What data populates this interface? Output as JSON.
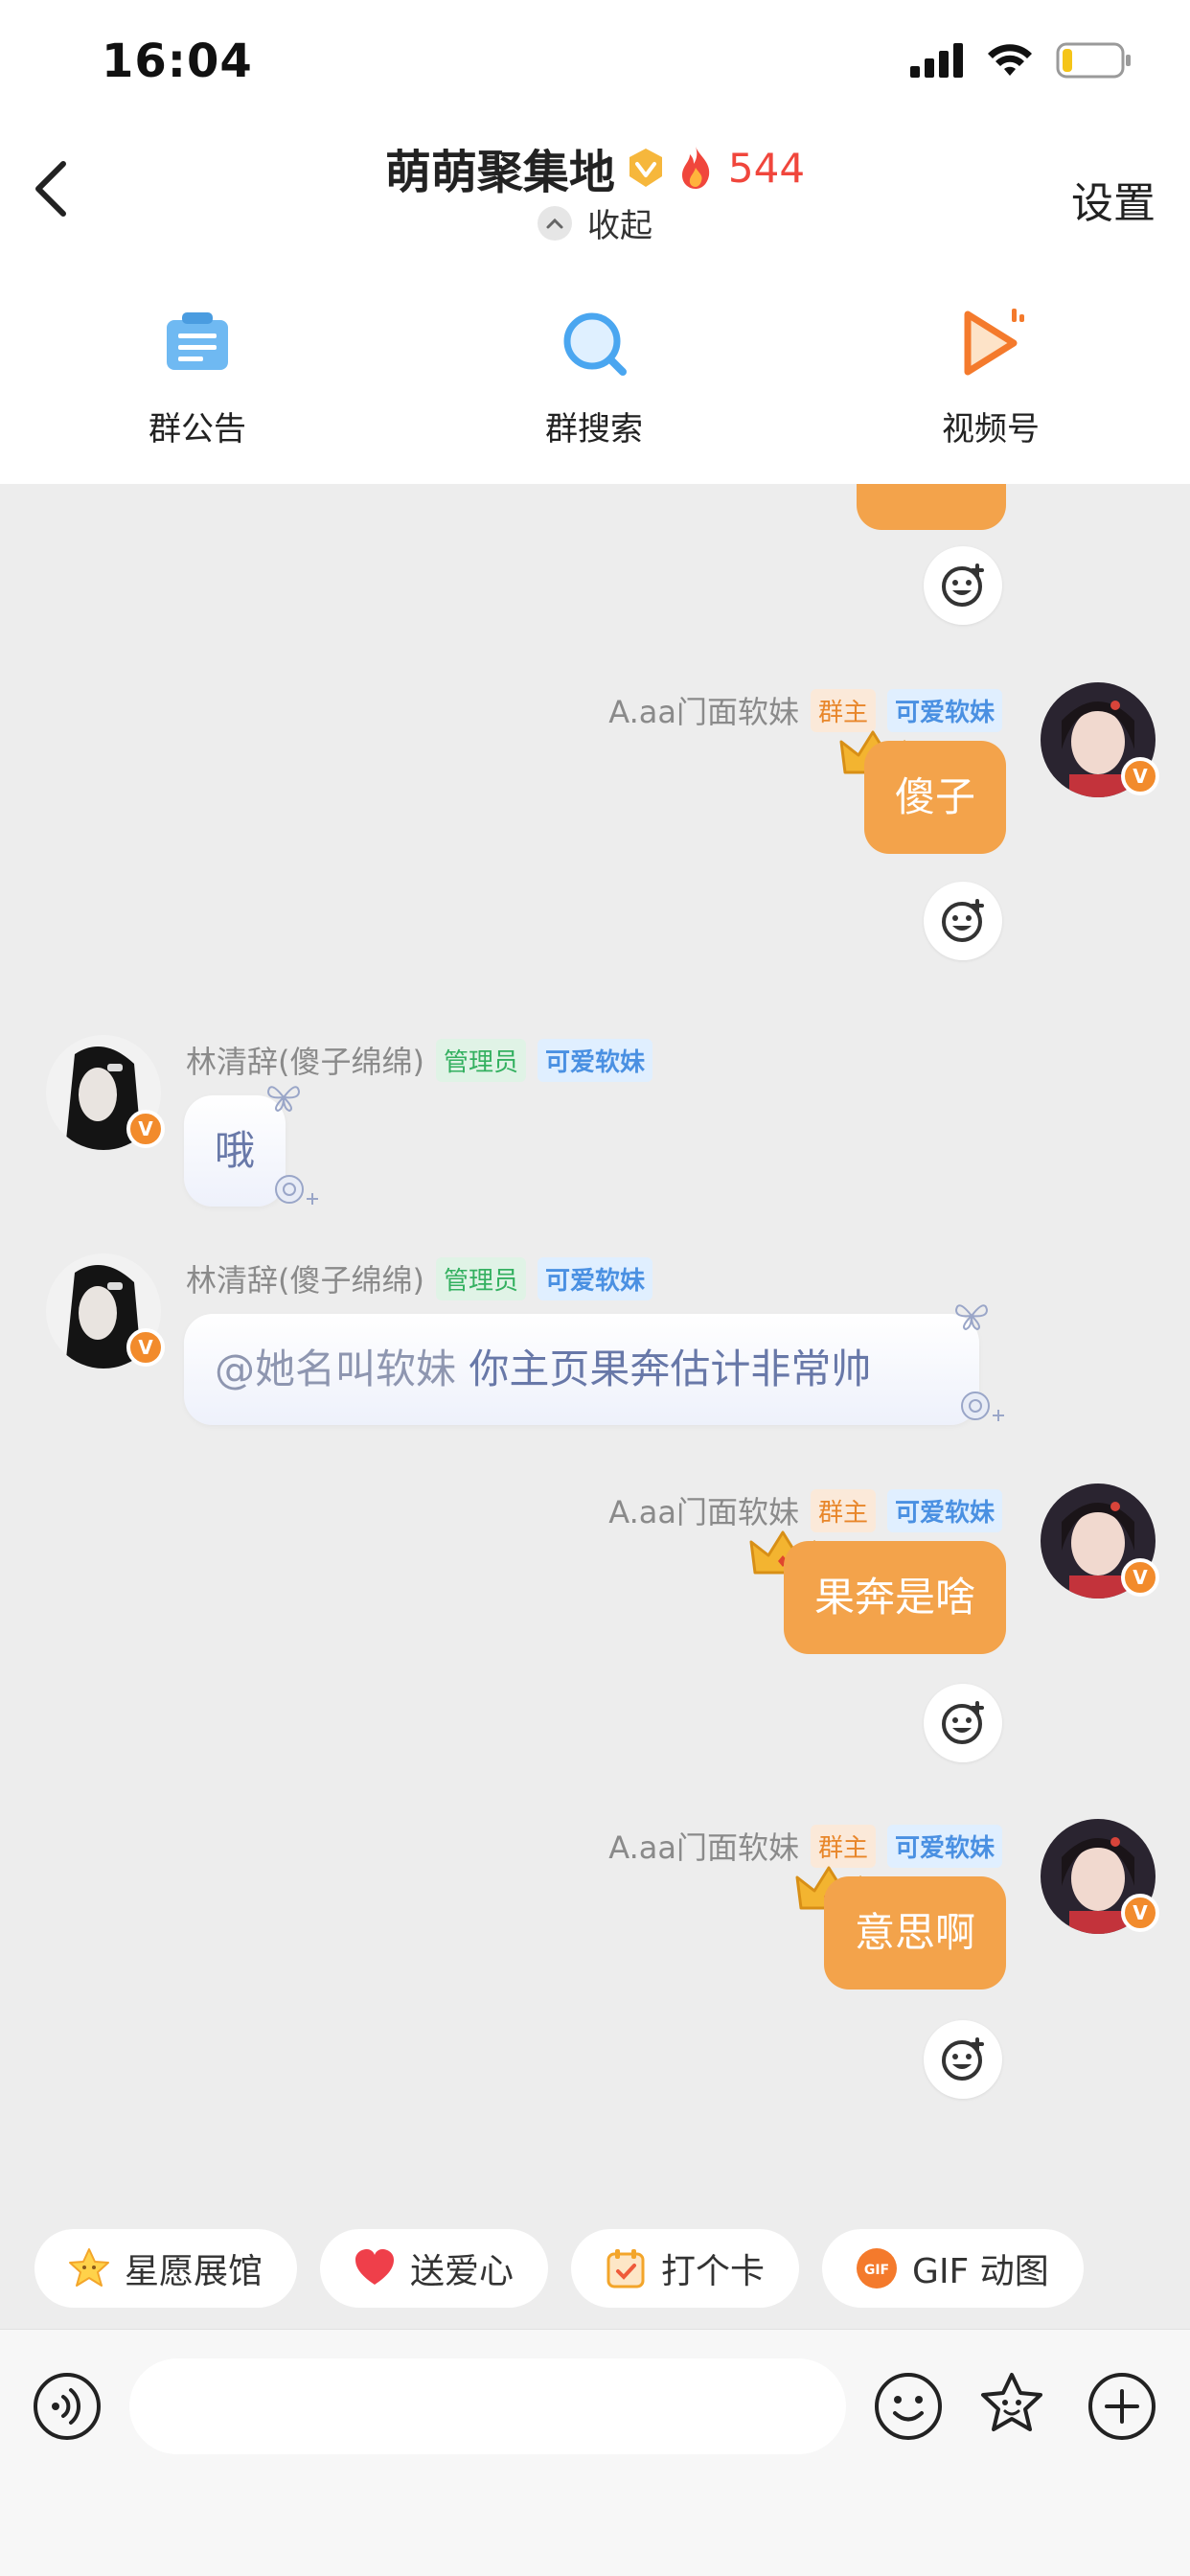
{
  "status": {
    "time": "16:04"
  },
  "header": {
    "title": "萌萌聚集地",
    "heat": "544",
    "collapse_label": "收起",
    "settings_label": "设置"
  },
  "quick_actions": [
    {
      "label": "群公告",
      "icon": "announcement-icon"
    },
    {
      "label": "群搜索",
      "icon": "search-icon"
    },
    {
      "label": "视频号",
      "icon": "video-channel-icon"
    }
  ],
  "messages": [
    {
      "side": "right",
      "sender": "A.aa门面软妹",
      "role": "群主",
      "title": "可爱软妹",
      "text": "傻子"
    },
    {
      "side": "left",
      "sender": "林清辞(傻子绵绵)",
      "role": "管理员",
      "title": "可爱软妹",
      "text": "哦"
    },
    {
      "side": "left",
      "sender": "林清辞(傻子绵绵)",
      "role": "管理员",
      "title": "可爱软妹",
      "mention": "@她名叫软妹",
      "text": "你主页果奔估计非常帅"
    },
    {
      "side": "right",
      "sender": "A.aa门面软妹",
      "role": "群主",
      "title": "可爱软妹",
      "text": "果奔是啥"
    },
    {
      "side": "right",
      "sender": "A.aa门面软妹",
      "role": "群主",
      "title": "可爱软妹",
      "text": "意思啊"
    }
  ],
  "chips": [
    {
      "label": "星愿展馆",
      "icon": "star-icon"
    },
    {
      "label": "送爱心",
      "icon": "heart-icon"
    },
    {
      "label": "打个卡",
      "icon": "checkin-icon"
    },
    {
      "label": "GIF 动图",
      "icon": "gif-icon"
    }
  ],
  "input": {
    "placeholder": ""
  },
  "colors": {
    "bubble_self": "#f3a34b",
    "accent_heat": "#f0463c",
    "chat_bg": "#ededed"
  }
}
